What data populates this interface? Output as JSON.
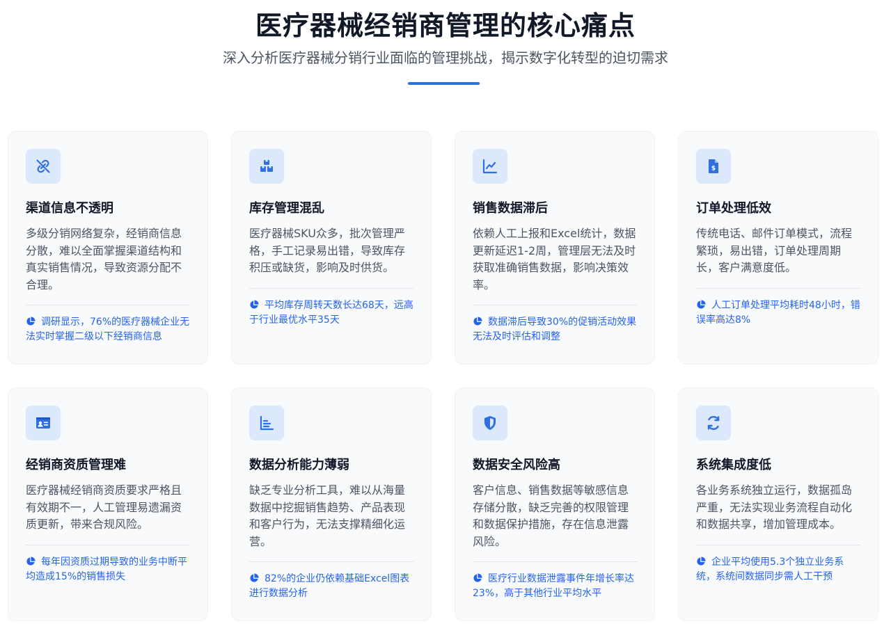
{
  "header": {
    "title": "医疗器械经销商管理的核心痛点",
    "subtitle": "深入分析医疗器械分销行业面临的管理挑战，揭示数字化转型的迫切需求"
  },
  "colors": {
    "accent": "#2f6fe0",
    "icon_bg": "#dce8fb",
    "stat_text": "#2563eb",
    "card_bg": "#f8fafc"
  },
  "cards": [
    {
      "icon": "broken-link-icon",
      "title": "渠道信息不透明",
      "desc": "多级分销网络复杂，经销商信息分散，难以全面掌握渠道结构和真实销售情况，导致资源分配不合理。",
      "stat": "调研显示，76%的医疗器械企业无法实时掌握二级以下经销商信息"
    },
    {
      "icon": "boxes-icon",
      "title": "库存管理混乱",
      "desc": "医疗器械SKU众多，批次管理严格，手工记录易出错，导致库存积压或缺货，影响及时供货。",
      "stat": "平均库存周转天数长达68天，远高于行业最优水平35天"
    },
    {
      "icon": "line-chart-icon",
      "title": "销售数据滞后",
      "desc": "依赖人工上报和Excel统计，数据更新延迟1-2周，管理层无法及时获取准确销售数据，影响决策效率。",
      "stat": "数据滞后导致30%的促销活动效果无法及时评估和调整"
    },
    {
      "icon": "invoice-dollar-icon",
      "title": "订单处理低效",
      "desc": "传统电话、邮件订单模式，流程繁琐，易出错，订单处理周期长，客户满意度低。",
      "stat": "人工订单处理平均耗时48小时，错误率高达8%"
    },
    {
      "icon": "id-card-icon",
      "title": "经销商资质管理难",
      "desc": "医疗器械经销商资质要求严格且有效期不一，人工管理易遗漏资质更新，带来合规风险。",
      "stat": "每年因资质过期导致的业务中断平均造成15%的销售损失"
    },
    {
      "icon": "bar-chart-icon",
      "title": "数据分析能力薄弱",
      "desc": "缺乏专业分析工具，难以从海量数据中挖掘销售趋势、产品表现和客户行为，无法支撑精细化运营。",
      "stat": "82%的企业仍依赖基础Excel图表进行数据分析"
    },
    {
      "icon": "shield-icon",
      "title": "数据安全风险高",
      "desc": "客户信息、销售数据等敏感信息存储分散，缺乏完善的权限管理和数据保护措施，存在信息泄露风险。",
      "stat": "医疗行业数据泄露事件年增长率达23%，高于其他行业平均水平"
    },
    {
      "icon": "sync-icon",
      "title": "系统集成度低",
      "desc": "各业务系统独立运行，数据孤岛严重，无法实现业务流程自动化和数据共享，增加管理成本。",
      "stat": "企业平均使用5.3个独立业务系统，系统间数据同步需人工干预"
    }
  ]
}
